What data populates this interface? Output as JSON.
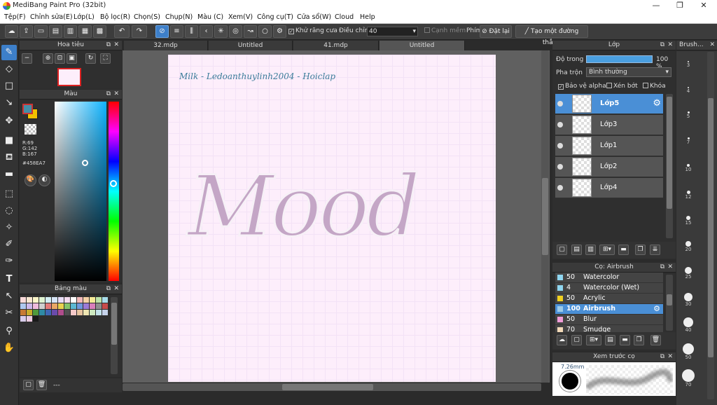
{
  "window": {
    "title": "MediBang Paint Pro (32bit)",
    "min": "—",
    "max": "❐",
    "close": "✕"
  },
  "menu": [
    "Tệp(F)",
    "Chỉnh sửa(E)",
    "Lớp(L)",
    "Bộ lọc(R)",
    "Chọn(S)",
    "Chụp(N)",
    "Màu (C)",
    "Xem(V)",
    "Công cụ(T)",
    "Cửa sổ(W)",
    "Cloud",
    "Help"
  ],
  "toolbar": {
    "antialias": "Khử răng cưa",
    "adjust": "Điều chỉnh",
    "adjust_value": "40",
    "smooth": "Cạnh mềm",
    "key": "Phím",
    "reset": "Đặt lại",
    "ruler": "Tạo một đường thẳng"
  },
  "tabs": [
    "32.mdp",
    "Untitled",
    "41.mdp",
    "Untitled"
  ],
  "navigator": {
    "title": "Hoa tiêu"
  },
  "color": {
    "title": "Màu",
    "r": "R:69",
    "g": "G:142",
    "b": "B:167",
    "hex": "#458EA7",
    "primary": "#458ea7",
    "secondary": "#f2c200"
  },
  "palette": {
    "title": "Bảng màu",
    "colors": [
      "#f9d9d9",
      "#f8e7d0",
      "#fbf6c9",
      "#dff3d2",
      "#d3eef4",
      "#d6e4f6",
      "#e7dcf5",
      "#f6dcef",
      "#ffffff",
      "#f2b9b9",
      "#f5d1a6",
      "#f6ea97",
      "#bde3a8",
      "#a7dcea",
      "#aec8ef",
      "#cdb8ec",
      "#eebadd",
      "#cfcfcf",
      "#e37b7b",
      "#eaa765",
      "#e9d14f",
      "#85c46a",
      "#5cb8d3",
      "#6f98dd",
      "#9c7ad6",
      "#da7fbb",
      "#8f8f8f",
      "#c54b4b",
      "#c77a32",
      "#c7ac2a",
      "#4f9a3c",
      "#2f8ba6",
      "#3f66b5",
      "#6b4bac",
      "#b04d8c",
      "#4f4f4f",
      "#f5c9c9",
      "#e8c4a0",
      "#efe6b2",
      "#cde9c0",
      "#c2e2ea",
      "#c6d3ea",
      "#d8cdea",
      "#ebcce0",
      "#1a1a1a"
    ],
    "footer": "---"
  },
  "canvas": {
    "signature": "Milk - Ledoanthuylinh2004 - Hoiclap",
    "word": "Mood"
  },
  "layers": {
    "title": "Lớp",
    "opacity_label": "Độ trong",
    "opacity_value": "100 %",
    "blend_label": "Pha trộn",
    "blend_value": "Bình thường",
    "protect_alpha": "Bảo vệ alpha",
    "clip": "Xén bớt",
    "lock": "Khóa",
    "items": [
      "Lớp5",
      "Lớp3",
      "Lớp1",
      "Lớp2",
      "Lớp4"
    ]
  },
  "brushes": {
    "title": "Cọ: Airbrush",
    "items": [
      {
        "size": "50",
        "name": "Watercolor",
        "color": "#8fd6f0"
      },
      {
        "size": "4",
        "name": "Watercolor (Wet)",
        "color": "#8fd6f0"
      },
      {
        "size": "50",
        "name": "Acrylic",
        "color": "#f0d020"
      },
      {
        "size": "100",
        "name": "Airbrush",
        "color": "#9ecbe8"
      },
      {
        "size": "50",
        "name": "Blur",
        "color": "#f09cd8"
      },
      {
        "size": "70",
        "name": "Smudge",
        "color": "#f2d9b8"
      }
    ]
  },
  "preview": {
    "title": "Xem trước cọ",
    "size": "7.26mm"
  },
  "brush_sizes": {
    "title": "Brush...",
    "values": [
      "3",
      "4",
      "5",
      "7",
      "10",
      "12",
      "15",
      "20",
      "25",
      "30",
      "40",
      "50",
      "70"
    ]
  }
}
